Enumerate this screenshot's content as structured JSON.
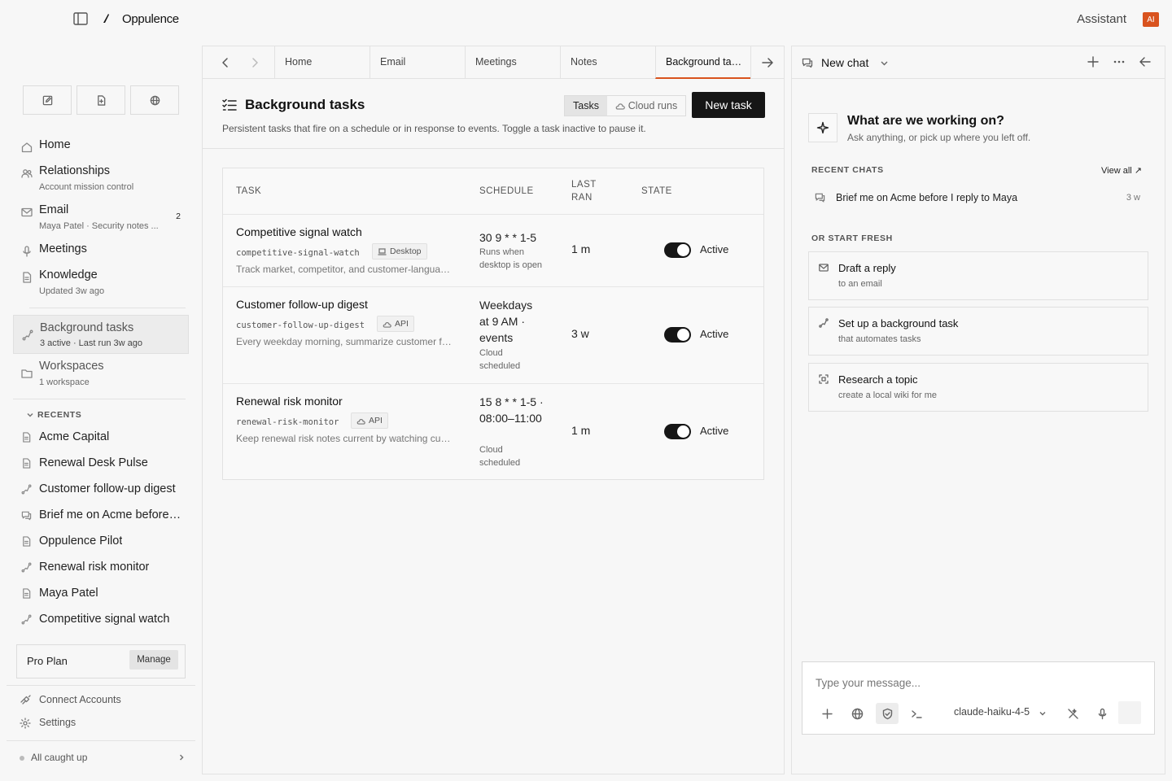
{
  "app": {
    "name": "Oppulence",
    "assistant_label": "Assistant",
    "ai_badge": "AI",
    "accent": "#d9531e"
  },
  "sidebar": {
    "quick_actions": [
      {
        "icon": "edit-icon"
      },
      {
        "icon": "new-file-icon"
      },
      {
        "icon": "globe-icon"
      }
    ],
    "nav": [
      {
        "label": "Home",
        "icon": "home-icon"
      },
      {
        "label": "Relationships",
        "sub": "Account mission control",
        "icon": "people-icon"
      },
      {
        "label": "Email",
        "sub": "Maya Patel · Security notes ...",
        "count": "2",
        "icon": "mail-icon"
      },
      {
        "label": "Meetings",
        "icon": "mic-icon"
      },
      {
        "label": "Knowledge",
        "sub": "Updated 3w ago",
        "icon": "document-icon"
      },
      {
        "label": "Background tasks",
        "sub": "3 active · Last run 3w ago",
        "icon": "automation-icon"
      },
      {
        "label": "Workspaces",
        "sub": "1 workspace",
        "icon": "folder-icon"
      }
    ],
    "recents_label": "RECENTS",
    "recents": [
      {
        "label": "Acme Capital",
        "icon": "document-icon"
      },
      {
        "label": "Renewal Desk Pulse",
        "icon": "document-icon"
      },
      {
        "label": "Customer follow-up digest",
        "icon": "automation-icon"
      },
      {
        "label": "Brief me on Acme before I reply to Maya",
        "icon": "chat-icon"
      },
      {
        "label": "Oppulence Pilot",
        "icon": "document-icon"
      },
      {
        "label": "Renewal risk monitor",
        "icon": "automation-icon"
      },
      {
        "label": "Maya Patel",
        "icon": "document-icon"
      },
      {
        "label": "Competitive signal watch",
        "icon": "automation-icon"
      }
    ],
    "plan": {
      "label": "Pro Plan",
      "manage": "Manage"
    },
    "footer": {
      "connect": "Connect Accounts",
      "settings": "Settings",
      "status": "All caught up"
    }
  },
  "tabs": [
    "Home",
    "Email",
    "Meetings",
    "Notes",
    "Background tasks"
  ],
  "page": {
    "title": "Background tasks",
    "description": "Persistent tasks that fire on a schedule or in response to events. Toggle a task inactive to pause it.",
    "segments": [
      "Tasks",
      "Cloud runs"
    ],
    "new_task": "New task"
  },
  "table": {
    "headers": {
      "task": "TASK",
      "schedule": "SCHEDULE",
      "last_ran": "LAST RAN",
      "state": "STATE"
    },
    "rows": [
      {
        "name": "Competitive signal watch",
        "slug": "competitive-signal-watch",
        "badge": "Desktop",
        "badge_icon": "laptop-icon",
        "desc": "Track market, competitor, and customer-language signals",
        "schedule": "30 9 * * 1-5",
        "schedule_sub": "Runs when desktop is open",
        "last_ran": "1 m",
        "state": "Active",
        "active": true
      },
      {
        "name": "Customer follow-up digest",
        "slug": "customer-follow-up-digest",
        "badge": "API",
        "badge_icon": "cloud-icon",
        "desc": "Every weekday morning, summarize customer follow-ups",
        "schedule": "Weekdays at 9 AM · events",
        "schedule_sub": "Cloud scheduled",
        "last_ran": "3 w",
        "state": "Active",
        "active": true
      },
      {
        "name": "Renewal risk monitor",
        "slug": "renewal-risk-monitor",
        "badge": "API",
        "badge_icon": "cloud-icon",
        "desc": "Keep renewal risk notes current by watching customer signals",
        "schedule": "15 8 * * 1-5 · 08:00–11:00",
        "schedule_sub": "Cloud scheduled",
        "last_ran": "1 m",
        "state": "Active",
        "active": true
      }
    ]
  },
  "chat": {
    "title": "New chat",
    "hero_title": "What are we working on?",
    "hero_sub": "Ask anything, or pick up where you left off.",
    "recent_label": "RECENT CHATS",
    "view_all": "View all ↗",
    "recent": [
      {
        "title": "Brief me on Acme before I reply to Maya",
        "time": "3 w"
      }
    ],
    "fresh_label": "OR START FRESH",
    "fresh": [
      {
        "title": "Draft a reply",
        "sub": "to an email",
        "icon": "mail-icon"
      },
      {
        "title": "Set up a background task",
        "sub": "that automates tasks",
        "icon": "automation-icon"
      },
      {
        "title": "Research a topic",
        "sub": "create a local wiki for me",
        "icon": "scan-icon"
      }
    ],
    "composer": {
      "placeholder": "Type your message...",
      "model": "claude-haiku-4-5"
    }
  }
}
